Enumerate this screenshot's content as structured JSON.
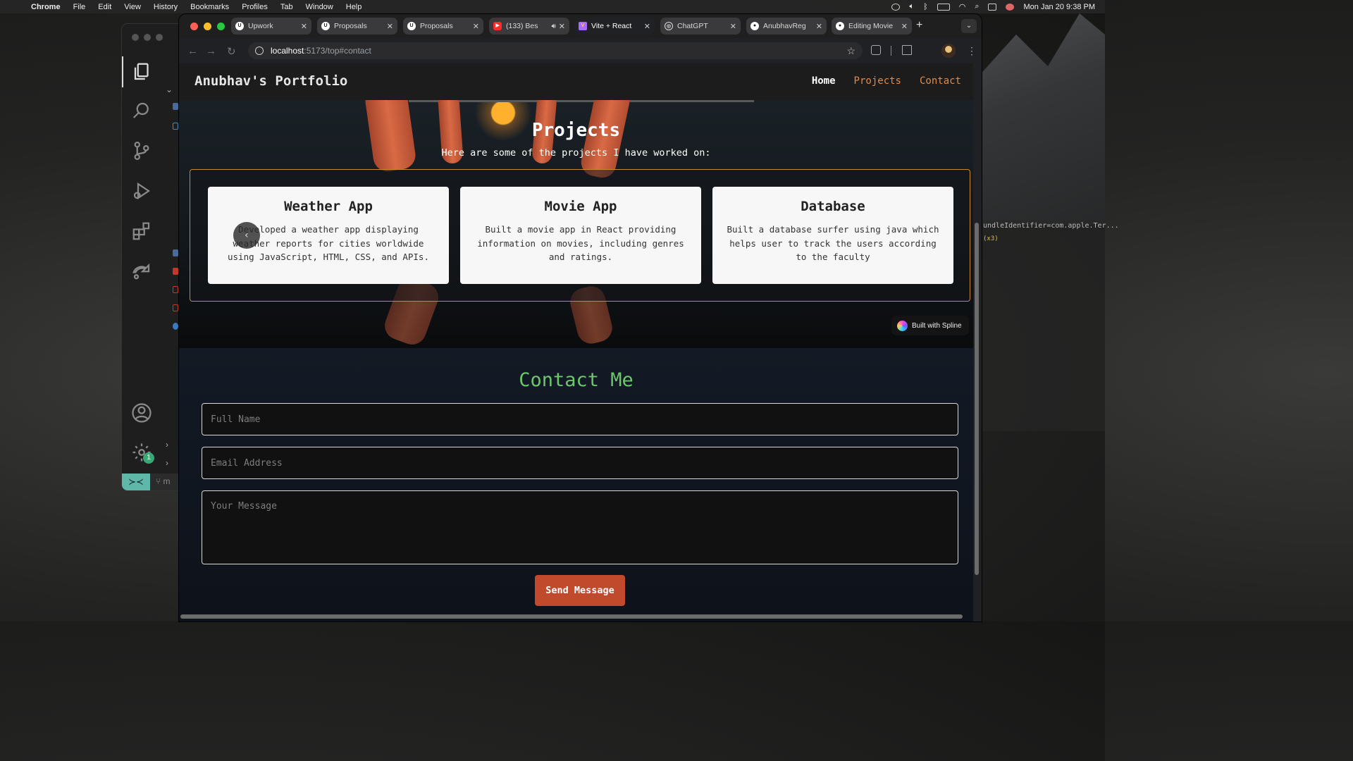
{
  "menubar": {
    "app": "Chrome",
    "items": [
      "File",
      "Edit",
      "View",
      "History",
      "Bookmarks",
      "Profiles",
      "Tab",
      "Window",
      "Help"
    ],
    "clock": "Mon Jan 20  9:38 PM"
  },
  "terminal": {
    "line1": "undleIdentifier=com.apple.Ter...",
    "line2": "(x3)"
  },
  "vscode": {
    "badge_count": "1",
    "branch_label": "m"
  },
  "tabs": [
    {
      "title": "Upwork",
      "favicon": "U",
      "color": "#ffffff"
    },
    {
      "title": "Proposals",
      "favicon": "U",
      "color": "#ffffff"
    },
    {
      "title": "Proposals",
      "favicon": "U",
      "color": "#ffffff"
    },
    {
      "title": "(133) Bes",
      "favicon": "▶",
      "color": "#ff2b2b"
    },
    {
      "title": "Vite + React",
      "favicon": "V",
      "color": "#a96bff"
    },
    {
      "title": "ChatGPT",
      "favicon": "◎",
      "color": "#ffffff"
    },
    {
      "title": "AnubhavReg",
      "favicon": "●",
      "color": "#ffffff"
    },
    {
      "title": "Editing Movie",
      "favicon": "●",
      "color": "#ffffff"
    }
  ],
  "omnibox": {
    "host": "localhost",
    "path": ":5173/top#contact"
  },
  "site": {
    "brand": "Anubhav's Portfolio",
    "nav": {
      "home": "Home",
      "projects": "Projects",
      "contact": "Contact"
    },
    "projects_title": "Projects",
    "projects_subtitle": "Here are some of the projects I have worked on:",
    "projects": [
      {
        "title": "Weather App",
        "desc": "Developed a weather app displaying weather reports for cities worldwide using JavaScript, HTML, CSS, and APIs."
      },
      {
        "title": "Movie App",
        "desc": "Built a movie app in React providing information on movies, including genres and ratings."
      },
      {
        "title": "Database",
        "desc": "Built a database surfer using java which helps user to track the users according to the faculty"
      }
    ],
    "spline_badge": "Built with Spline",
    "contact": {
      "title": "Contact Me",
      "name_placeholder": "Full Name",
      "email_placeholder": "Email Address",
      "message_placeholder": "Your Message",
      "send_label": "Send Message"
    }
  },
  "colors": {
    "accent_orange": "#e08a4a",
    "contact_green": "#6cc76a",
    "button_red": "#c24a2c",
    "card_border": "#c88a2c"
  }
}
